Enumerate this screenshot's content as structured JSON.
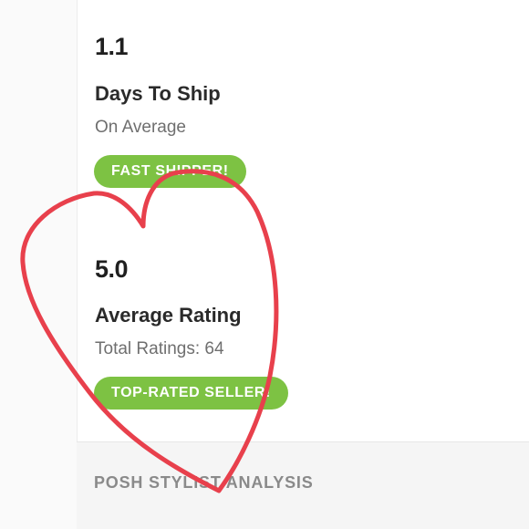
{
  "shipping": {
    "value": "1.1",
    "title": "Days To Ship",
    "subtitle": "On Average",
    "badge": "FAST SHIPPER!"
  },
  "rating": {
    "value": "5.0",
    "title": "Average Rating",
    "subtitle": "Total Ratings: 64",
    "badge": "TOP-RATED SELLER!"
  },
  "section": {
    "title": "POSH STYLIST ANALYSIS"
  },
  "colors": {
    "badge_green": "#7dc243",
    "heart_red": "#e8404c",
    "section_bg": "#f5f5f5"
  },
  "overlay": {
    "shape": "hand-drawn-heart"
  }
}
